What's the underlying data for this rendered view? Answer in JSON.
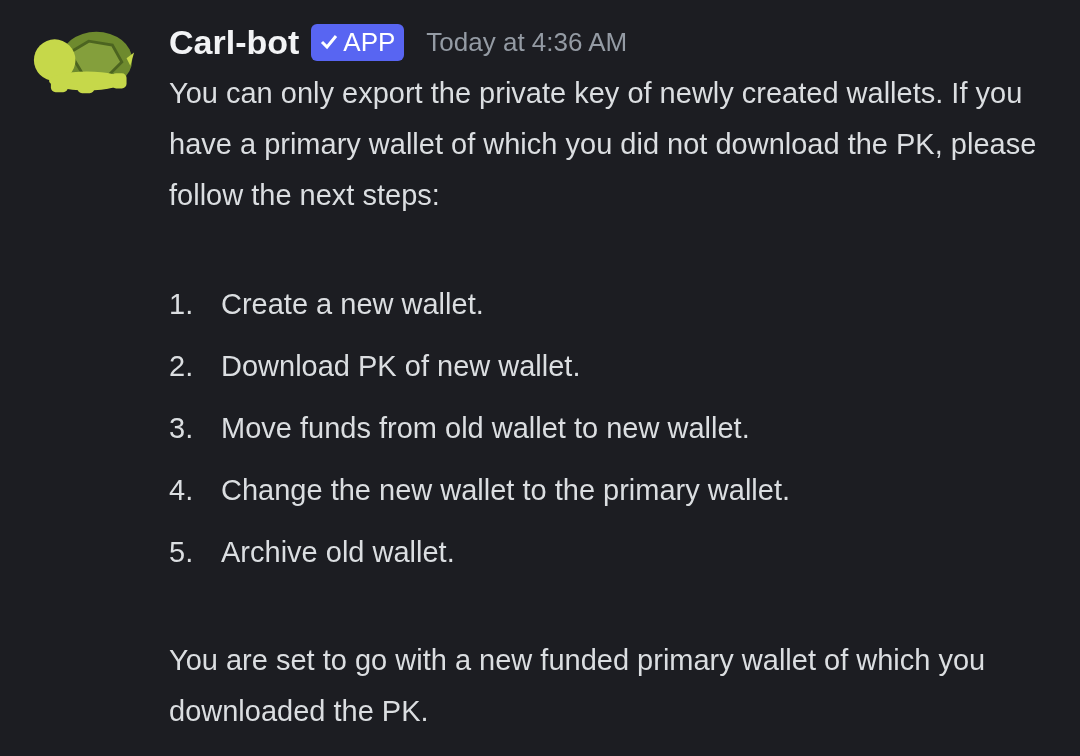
{
  "message": {
    "author": "Carl-bot",
    "badge": "APP",
    "badge_verified": true,
    "timestamp": "Today at 4:36 AM",
    "intro": "You can only export the private key of newly created wallets. If you have a primary wallet of which you did not download the PK, please follow the next steps:",
    "steps": [
      {
        "number": "1.",
        "text": "Create a new wallet."
      },
      {
        "number": "2.",
        "text": "Download PK of new wallet."
      },
      {
        "number": "3.",
        "text": "Move funds from old wallet to new wallet."
      },
      {
        "number": "4.",
        "text": "Change the new wallet to the primary wallet."
      },
      {
        "number": "5.",
        "text": "Archive old wallet."
      }
    ],
    "outro": "You are set to go with a new funded primary wallet of which you downloaded the PK."
  }
}
